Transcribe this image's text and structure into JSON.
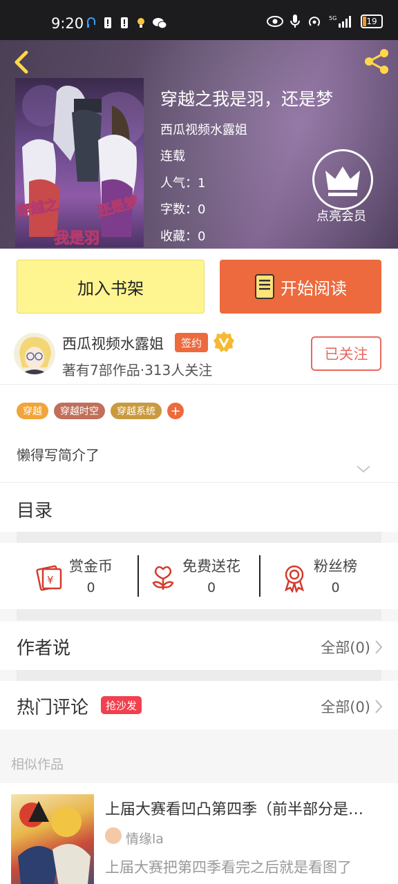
{
  "status_bar": {
    "time": "9:20",
    "battery": "19",
    "network": "5G"
  },
  "book": {
    "title": "穿越之我是羽，还是梦",
    "author_line": "西瓜视频水露姐",
    "status": "连载",
    "popularity_label": "人气：1",
    "words_label": "字数：0",
    "favorites_label": "收藏：0",
    "cover_text_1": "穿越之",
    "cover_text_2": "还是梦",
    "cover_text_3": "我是羽",
    "vip_label": "点亮会员"
  },
  "actions": {
    "add_shelf": "加入书架",
    "start_read": "开始阅读"
  },
  "author": {
    "name": "西瓜视频水露姐",
    "sign_badge": "签约",
    "stats": "著有7部作品·313人关注",
    "follow_label": "已关注"
  },
  "tags": [
    {
      "label": "穿越",
      "color": "#f0a43a"
    },
    {
      "label": "穿越时空",
      "color": "#c0705a"
    },
    {
      "label": "穿越系统",
      "color": "#c99a3f"
    }
  ],
  "intro": {
    "text": "懒得写简介了"
  },
  "catalog": {
    "label": "目录"
  },
  "fan_bar": {
    "items": [
      {
        "label": "赏金币",
        "value": "0"
      },
      {
        "label": "免费送花",
        "value": "0"
      },
      {
        "label": "粉丝榜",
        "value": "0"
      }
    ]
  },
  "author_says": {
    "label": "作者说",
    "more": "全部(0)"
  },
  "hot_comments": {
    "label": "热门评论",
    "badge": "抢沙发",
    "more": "全部(0)"
  },
  "similar": {
    "section_title": "相似作品",
    "items": [
      {
        "title": "上届大赛看凹凸第四季（前半部分是…",
        "author": "情缘la",
        "desc": "上届大赛把第四季看完之后就是看图了"
      }
    ]
  },
  "colors": {
    "accent": "#ec6a3d",
    "shelf_button": "#fff590",
    "follow": "#e8685f",
    "hot_badge": "#f1404f"
  }
}
